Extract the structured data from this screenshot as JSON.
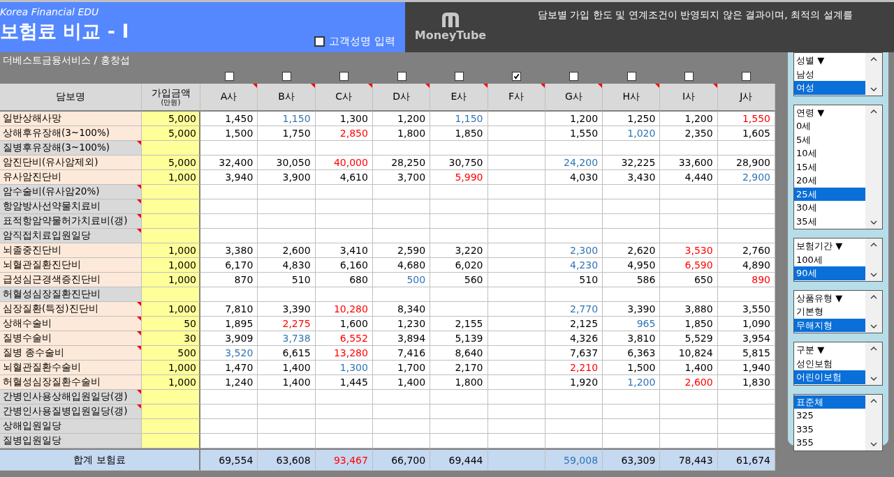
{
  "header": {
    "brand": "Korea Financial EDU",
    "title": "보험료 비교 - I",
    "customer_name_toggle": {
      "label": "고객성명 입력",
      "checked": false
    },
    "logo_text": "MoneyTube",
    "notice": "담보별 가입 한도 및 연계조건이 반영되지 않은 결과이며, 최적의 설계를"
  },
  "subtitle": "더베스트금융서비스 / 홍창섭",
  "table": {
    "columns": {
      "name": "담보명",
      "amount": "가입금액",
      "amount_unit": "(만원)"
    },
    "companies": [
      {
        "label": "A사",
        "checked": false,
        "note": true
      },
      {
        "label": "B사",
        "checked": false,
        "note": true
      },
      {
        "label": "C사",
        "checked": false,
        "note": true
      },
      {
        "label": "D사",
        "checked": false,
        "note": true
      },
      {
        "label": "E사",
        "checked": false,
        "note": true
      },
      {
        "label": "F사",
        "checked": true,
        "note": true
      },
      {
        "label": "G사",
        "checked": false,
        "note": true
      },
      {
        "label": "H사",
        "checked": false,
        "note": true
      },
      {
        "label": "I사",
        "checked": false,
        "note": true
      },
      {
        "label": "J사",
        "checked": false,
        "note": false
      }
    ],
    "rows": [
      {
        "name": "일반상해사망",
        "kind": "active",
        "note": false,
        "amount": "5,000",
        "cells": [
          {
            "text": "1,450",
            "color": "#000000"
          },
          {
            "text": "1,150",
            "color": "#2e75b6"
          },
          {
            "text": "1,300",
            "color": "#000000"
          },
          {
            "text": "1,200",
            "color": "#000000"
          },
          {
            "text": "1,150",
            "color": "#2e75b6"
          },
          null,
          {
            "text": "1,200",
            "color": "#000000"
          },
          {
            "text": "1,250",
            "color": "#000000"
          },
          {
            "text": "1,200",
            "color": "#000000"
          },
          {
            "text": "1,550",
            "color": "#ff0000"
          }
        ]
      },
      {
        "name": "상해후유장해(3~100%)",
        "kind": "active",
        "note": false,
        "amount": "5,000",
        "cells": [
          {
            "text": "1,500",
            "color": "#000000"
          },
          {
            "text": "1,750",
            "color": "#000000"
          },
          {
            "text": "2,850",
            "color": "#ff0000"
          },
          {
            "text": "1,800",
            "color": "#000000"
          },
          {
            "text": "1,850",
            "color": "#000000"
          },
          null,
          {
            "text": "1,550",
            "color": "#000000"
          },
          {
            "text": "1,020",
            "color": "#2e75b6"
          },
          {
            "text": "2,350",
            "color": "#000000"
          },
          {
            "text": "1,605",
            "color": "#000000"
          }
        ]
      },
      {
        "name": "질병후유장해(3~100%)",
        "kind": "inactive",
        "note": true,
        "cells": [
          null,
          null,
          null,
          null,
          null,
          null,
          null,
          null,
          null,
          null
        ]
      },
      {
        "name": "암진단비(유사암제외)",
        "kind": "active",
        "note": false,
        "amount": "5,000",
        "cells": [
          {
            "text": "32,400",
            "color": "#000000"
          },
          {
            "text": "30,050",
            "color": "#000000"
          },
          {
            "text": "40,000",
            "color": "#ff0000"
          },
          {
            "text": "28,250",
            "color": "#000000"
          },
          {
            "text": "30,750",
            "color": "#000000"
          },
          null,
          {
            "text": "24,200",
            "color": "#2e75b6"
          },
          {
            "text": "32,225",
            "color": "#000000"
          },
          {
            "text": "33,600",
            "color": "#000000"
          },
          {
            "text": "28,900",
            "color": "#000000"
          }
        ]
      },
      {
        "name": "유사암진단비",
        "kind": "active",
        "note": false,
        "amount": "1,000",
        "cells": [
          {
            "text": "3,940",
            "color": "#000000"
          },
          {
            "text": "3,900",
            "color": "#000000"
          },
          {
            "text": "4,610",
            "color": "#000000"
          },
          {
            "text": "3,700",
            "color": "#000000"
          },
          {
            "text": "5,990",
            "color": "#ff0000"
          },
          null,
          {
            "text": "4,030",
            "color": "#000000"
          },
          {
            "text": "3,430",
            "color": "#000000"
          },
          {
            "text": "4,440",
            "color": "#000000"
          },
          {
            "text": "2,900",
            "color": "#2e75b6"
          }
        ]
      },
      {
        "name": "암수술비(유사암20%)",
        "kind": "inactive",
        "note": true,
        "cells": [
          null,
          null,
          null,
          null,
          null,
          null,
          null,
          null,
          null,
          null
        ]
      },
      {
        "name": "항암방사선약물치료비",
        "kind": "inactive",
        "note": true,
        "cells": [
          null,
          null,
          null,
          null,
          null,
          null,
          null,
          null,
          null,
          null
        ]
      },
      {
        "name": "표적항암약물허가치료비(갱)",
        "kind": "inactive",
        "note": true,
        "cells": [
          null,
          null,
          null,
          null,
          null,
          null,
          null,
          null,
          null,
          null
        ]
      },
      {
        "name": "암직접치료입원일당",
        "kind": "inactive",
        "note": true,
        "cells": [
          null,
          null,
          null,
          null,
          null,
          null,
          null,
          null,
          null,
          null
        ]
      },
      {
        "name": "뇌졸중진단비",
        "kind": "active",
        "note": false,
        "amount": "1,000",
        "cells": [
          {
            "text": "3,380",
            "color": "#000000"
          },
          {
            "text": "2,600",
            "color": "#000000"
          },
          {
            "text": "3,410",
            "color": "#000000"
          },
          {
            "text": "2,590",
            "color": "#000000"
          },
          {
            "text": "3,220",
            "color": "#000000"
          },
          null,
          {
            "text": "2,300",
            "color": "#2e75b6"
          },
          {
            "text": "2,620",
            "color": "#000000"
          },
          {
            "text": "3,530",
            "color": "#ff0000"
          },
          {
            "text": "2,760",
            "color": "#000000"
          }
        ]
      },
      {
        "name": "뇌혈관질환진단비",
        "kind": "active",
        "note": false,
        "amount": "1,000",
        "cells": [
          {
            "text": "6,170",
            "color": "#000000"
          },
          {
            "text": "4,830",
            "color": "#000000"
          },
          {
            "text": "6,160",
            "color": "#000000"
          },
          {
            "text": "4,680",
            "color": "#000000"
          },
          {
            "text": "6,020",
            "color": "#000000"
          },
          null,
          {
            "text": "4,230",
            "color": "#2e75b6"
          },
          {
            "text": "4,950",
            "color": "#000000"
          },
          {
            "text": "6,590",
            "color": "#ff0000"
          },
          {
            "text": "4,890",
            "color": "#000000"
          }
        ]
      },
      {
        "name": "급성심근경색증진단비",
        "kind": "active",
        "note": false,
        "amount": "1,000",
        "cells": [
          {
            "text": "870",
            "color": "#000000"
          },
          {
            "text": "510",
            "color": "#000000"
          },
          {
            "text": "680",
            "color": "#000000"
          },
          {
            "text": "500",
            "color": "#2e75b6"
          },
          {
            "text": "560",
            "color": "#000000"
          },
          null,
          {
            "text": "510",
            "color": "#000000"
          },
          {
            "text": "586",
            "color": "#000000"
          },
          {
            "text": "650",
            "color": "#000000"
          },
          {
            "text": "890",
            "color": "#ff0000"
          }
        ]
      },
      {
        "name": "허혈성심장질환진단비",
        "kind": "inactive",
        "note": false,
        "cells": [
          null,
          null,
          null,
          null,
          null,
          null,
          null,
          null,
          null,
          null
        ]
      },
      {
        "name": "심장질환(특정)진단비",
        "kind": "active",
        "note": true,
        "amount": "1,000",
        "cells": [
          {
            "text": "7,810",
            "color": "#000000"
          },
          {
            "text": "3,390",
            "color": "#000000"
          },
          {
            "text": "10,280",
            "color": "#ff0000"
          },
          {
            "text": "8,340",
            "color": "#000000"
          },
          null,
          null,
          {
            "text": "2,770",
            "color": "#2e75b6"
          },
          {
            "text": "3,390",
            "color": "#000000"
          },
          {
            "text": "3,880",
            "color": "#000000"
          },
          {
            "text": "3,550",
            "color": "#000000"
          }
        ]
      },
      {
        "name": "상해수술비",
        "kind": "active",
        "note": true,
        "amount": "50",
        "cells": [
          {
            "text": "1,895",
            "color": "#000000"
          },
          {
            "text": "2,275",
            "color": "#ff0000"
          },
          {
            "text": "1,600",
            "color": "#000000"
          },
          {
            "text": "1,230",
            "color": "#000000"
          },
          {
            "text": "2,155",
            "color": "#000000"
          },
          null,
          {
            "text": "2,125",
            "color": "#000000"
          },
          {
            "text": "965",
            "color": "#2e75b6"
          },
          {
            "text": "1,850",
            "color": "#000000"
          },
          {
            "text": "1,090",
            "color": "#000000"
          }
        ]
      },
      {
        "name": "질병수술비",
        "kind": "active",
        "note": true,
        "amount": "30",
        "cells": [
          {
            "text": "3,909",
            "color": "#000000"
          },
          {
            "text": "3,738",
            "color": "#2e75b6"
          },
          {
            "text": "6,552",
            "color": "#ff0000"
          },
          {
            "text": "3,894",
            "color": "#000000"
          },
          {
            "text": "5,139",
            "color": "#000000"
          },
          null,
          {
            "text": "4,326",
            "color": "#000000"
          },
          {
            "text": "3,810",
            "color": "#000000"
          },
          {
            "text": "5,529",
            "color": "#000000"
          },
          {
            "text": "3,954",
            "color": "#000000"
          }
        ]
      },
      {
        "name": "질병 종수술비",
        "kind": "active",
        "note": true,
        "amount": "500",
        "cells": [
          {
            "text": "3,520",
            "color": "#2e75b6"
          },
          {
            "text": "6,615",
            "color": "#000000"
          },
          {
            "text": "13,280",
            "color": "#ff0000"
          },
          {
            "text": "7,416",
            "color": "#000000"
          },
          {
            "text": "8,640",
            "color": "#000000"
          },
          null,
          {
            "text": "7,637",
            "color": "#000000"
          },
          {
            "text": "6,363",
            "color": "#000000"
          },
          {
            "text": "10,824",
            "color": "#000000"
          },
          {
            "text": "5,815",
            "color": "#000000"
          }
        ]
      },
      {
        "name": "뇌혈관질환수술비",
        "kind": "active",
        "note": false,
        "amount": "1,000",
        "cells": [
          {
            "text": "1,470",
            "color": "#000000"
          },
          {
            "text": "1,400",
            "color": "#000000"
          },
          {
            "text": "1,300",
            "color": "#2e75b6"
          },
          {
            "text": "1,700",
            "color": "#000000"
          },
          {
            "text": "2,170",
            "color": "#000000"
          },
          null,
          {
            "text": "2,210",
            "color": "#ff0000"
          },
          {
            "text": "1,500",
            "color": "#000000"
          },
          {
            "text": "1,400",
            "color": "#000000"
          },
          {
            "text": "1,940",
            "color": "#000000"
          }
        ]
      },
      {
        "name": "허혈성심장질환수술비",
        "kind": "active",
        "note": false,
        "amount": "1,000",
        "cells": [
          {
            "text": "1,240",
            "color": "#000000"
          },
          {
            "text": "1,400",
            "color": "#000000"
          },
          {
            "text": "1,445",
            "color": "#000000"
          },
          {
            "text": "1,400",
            "color": "#000000"
          },
          {
            "text": "1,800",
            "color": "#000000"
          },
          null,
          {
            "text": "1,920",
            "color": "#000000"
          },
          {
            "text": "1,200",
            "color": "#2e75b6"
          },
          {
            "text": "2,600",
            "color": "#ff0000"
          },
          {
            "text": "1,830",
            "color": "#000000"
          }
        ]
      },
      {
        "name": "간병인사용상해입원일당(갱)",
        "kind": "inactive",
        "note": true,
        "cells": [
          null,
          null,
          null,
          null,
          null,
          null,
          null,
          null,
          null,
          null
        ]
      },
      {
        "name": "간병인사용질병입원일당(갱)",
        "kind": "inactive",
        "note": true,
        "cells": [
          null,
          null,
          null,
          null,
          null,
          null,
          null,
          null,
          null,
          null
        ]
      },
      {
        "name": "상해입원일당",
        "kind": "inactive",
        "note": false,
        "cells": [
          null,
          null,
          null,
          null,
          null,
          null,
          null,
          null,
          null,
          null
        ]
      },
      {
        "name": "질병입원일당",
        "kind": "inactive",
        "note": false,
        "cells": [
          null,
          null,
          null,
          null,
          null,
          null,
          null,
          null,
          null,
          null
        ]
      }
    ],
    "total": {
      "label": "합계 보험료",
      "cells": [
        {
          "text": "69,554",
          "color": "#000000"
        },
        {
          "text": "63,608",
          "color": "#000000"
        },
        {
          "text": "93,467",
          "color": "#ff0000"
        },
        {
          "text": "66,700",
          "color": "#000000"
        },
        {
          "text": "69,444",
          "color": "#000000"
        },
        null,
        {
          "text": "59,008",
          "color": "#2e75b6"
        },
        {
          "text": "63,309",
          "color": "#000000"
        },
        {
          "text": "78,443",
          "color": "#000000"
        },
        {
          "text": "61,674",
          "color": "#000000"
        }
      ]
    }
  },
  "filters": [
    {
      "items": [
        {
          "label": "성별 ▼",
          "selected": false
        },
        {
          "label": "남성",
          "selected": false
        },
        {
          "label": "여성",
          "selected": true
        }
      ]
    },
    {
      "items": [
        {
          "label": "연령 ▼",
          "selected": false
        },
        {
          "label": "0세",
          "selected": false
        },
        {
          "label": "5세",
          "selected": false
        },
        {
          "label": "10세",
          "selected": false
        },
        {
          "label": "15세",
          "selected": false
        },
        {
          "label": "20세",
          "selected": false
        },
        {
          "label": "25세",
          "selected": true
        },
        {
          "label": "30세",
          "selected": false
        },
        {
          "label": "35세",
          "selected": false
        }
      ]
    },
    {
      "items": [
        {
          "label": "보험기간 ▼",
          "selected": false
        },
        {
          "label": "100세",
          "selected": false
        },
        {
          "label": "90세",
          "selected": true
        }
      ]
    },
    {
      "items": [
        {
          "label": "상품유형 ▼",
          "selected": false
        },
        {
          "label": "기본형",
          "selected": false
        },
        {
          "label": "무해지형",
          "selected": true
        }
      ]
    },
    {
      "items": [
        {
          "label": "구분 ▼",
          "selected": false
        },
        {
          "label": "성인보험",
          "selected": false
        },
        {
          "label": "어린이보험",
          "selected": true
        }
      ]
    },
    {
      "items": [
        {
          "label": "표준체",
          "selected": true
        },
        {
          "label": "325",
          "selected": false
        },
        {
          "label": "335",
          "selected": false
        },
        {
          "label": "355",
          "selected": false
        }
      ]
    }
  ]
}
